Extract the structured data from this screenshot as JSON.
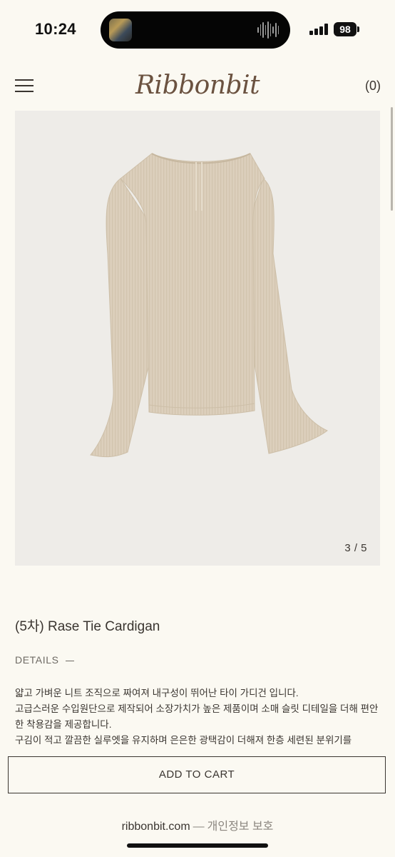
{
  "status_bar": {
    "time": "10:24",
    "battery": "98"
  },
  "header": {
    "logo": "Ribbonbit",
    "cart_count": "(0)"
  },
  "product": {
    "image_pager": "3 / 5",
    "title": "(5차) Rase Tie Cardigan",
    "details_label": "DETAILS",
    "description": [
      "얇고 가벼운 니트 조직으로 짜여져 내구성이 뛰어난 타이 가디건 입니다.",
      "고급스러운 수입원단으로 제작되어 소장가치가 높은 제품이며 소매 슬릿 디테일을 더해 편안한 착용감을 제공합니다.",
      "구김이 적고 깔끔한 실루엣을 유지하며 은은한 광택감이 더해져 한층 세련된 분위기를"
    ]
  },
  "actions": {
    "add_to_cart": "ADD TO CART"
  },
  "footer": {
    "domain": "ribbonbit.com",
    "separator": "—",
    "privacy": "개인정보 보호"
  },
  "colors": {
    "background": "#fbf9f2",
    "text": "#3a3530",
    "logo": "#6b5240",
    "garment": "#dccfbc"
  },
  "icons": [
    "menu-icon",
    "signal-icon",
    "battery-icon",
    "audio-wave-icon"
  ]
}
